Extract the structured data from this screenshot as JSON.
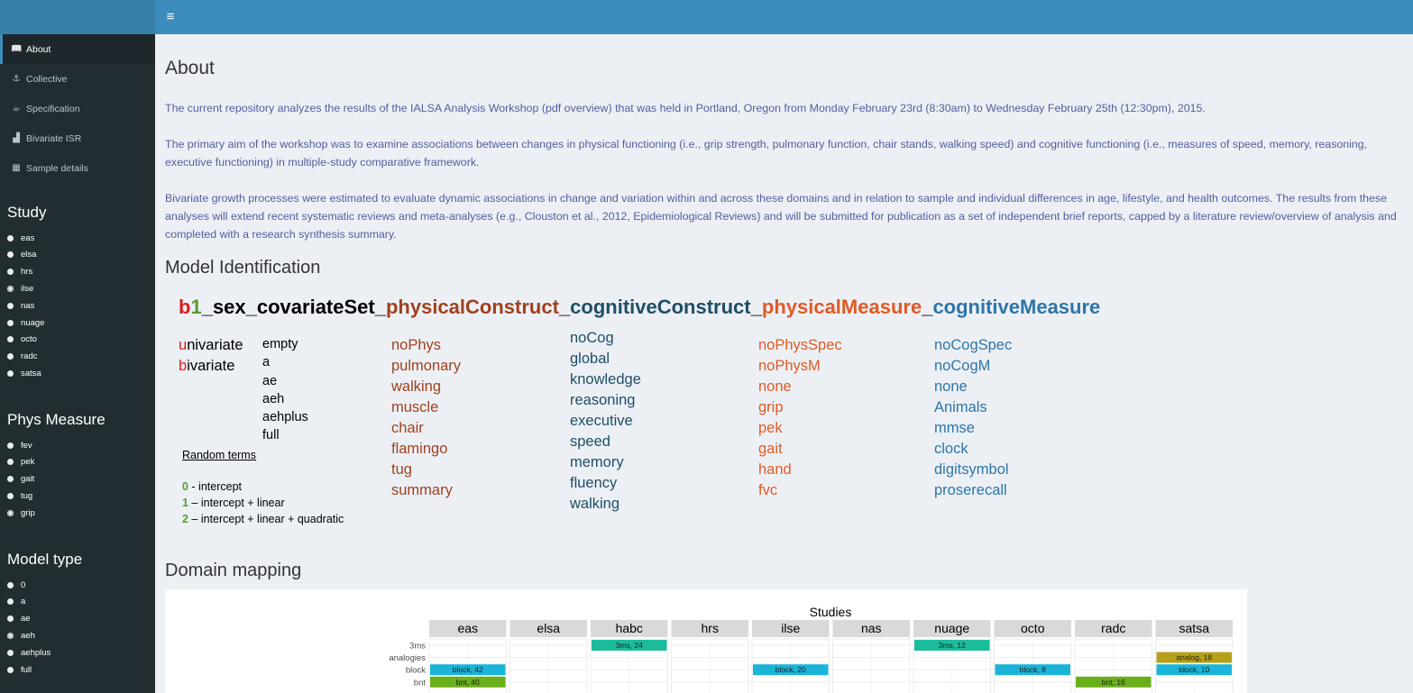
{
  "header": {
    "menu_icon": "hamburger-icon"
  },
  "sidebar": {
    "menu": [
      {
        "label": "About",
        "icon": "book-icon",
        "glyph": "📖",
        "active": true
      },
      {
        "label": "Collective",
        "icon": "anchor-icon",
        "glyph": "⚓",
        "active": false
      },
      {
        "label": "Specification",
        "icon": "coffee-icon",
        "glyph": "☕",
        "active": false
      },
      {
        "label": "Bivariate ISR",
        "icon": "area-chart-icon",
        "glyph": "▟",
        "active": false
      },
      {
        "label": "Sample details",
        "icon": "table-icon",
        "glyph": "▦",
        "active": false
      }
    ],
    "study": {
      "heading": "Study",
      "options": [
        "eas",
        "elsa",
        "hrs",
        "ilse",
        "nas",
        "nuage",
        "octo",
        "radc",
        "satsa"
      ],
      "selected": "ilse"
    },
    "phys_measure": {
      "heading": "Phys Measure",
      "options": [
        "fev",
        "pek",
        "gait",
        "tug",
        "grip"
      ],
      "selected": "grip"
    },
    "model_type": {
      "heading": "Model type",
      "options": [
        "0",
        "a",
        "ae",
        "aeh",
        "aehplus",
        "full"
      ],
      "selected": "aeh"
    }
  },
  "main": {
    "title": "About",
    "paragraphs": [
      "The current repository analyzes the results of the IALSA Analysis Workshop (pdf overview) that was held in Portland, Oregon from Monday February 23rd (8:30am) to Wednesday February 25th (12:30pm), 2015.",
      "The primary aim of the workshop was to examine associations between changes in physical functioning (i.e., grip strength, pulmonary function, chair stands, walking speed) and cognitive functioning (i.e., measures of speed, memory, reasoning, executive functioning) in multiple-study comparative framework.",
      "Bivariate growth processes were estimated to evaluate dynamic associations in change and variation within and across these domains and in relation to sample and individual differences in age, lifestyle, and health outcomes. The results from these analyses will extend recent systematic reviews and meta-analyses (e.g., Clouston et al., 2012, Epidemiological Reviews) and will be submitted for publication as a set of independent brief reports, capped by a literature review/overview of analysis and completed with a research synthesis summary."
    ],
    "model_identification": {
      "heading": "Model Identification",
      "title_parts": [
        "b",
        "1",
        "_sex_covariateSet_",
        "physicalConstruct",
        "_",
        "cognitiveConstruct",
        "_",
        "physicalMeasure",
        "_",
        "cognitiveMeasure"
      ],
      "type_first": [
        "u",
        "nivariate"
      ],
      "type_second": [
        "b",
        "ivariate"
      ],
      "covariate_sets": [
        "empty",
        "a",
        "ae",
        "aeh",
        "aehplus",
        "full"
      ],
      "physical_constructs": [
        "noPhys",
        "pulmonary",
        "walking",
        "muscle",
        "chair",
        "flamingo",
        "tug",
        "summary"
      ],
      "cognitive_constructs": [
        "noCog",
        "global",
        "knowledge",
        "reasoning",
        "executive",
        "speed",
        "memory",
        "fluency",
        "walking"
      ],
      "physical_measures": [
        "noPhysSpec",
        "noPhysM",
        "none",
        "grip",
        "pek",
        "gait",
        "hand",
        "fvc"
      ],
      "cognitive_measures": [
        "noCogSpec",
        "noCogM",
        "none",
        "Animals",
        "mmse",
        "clock",
        "digitsymbol",
        "proserecall"
      ],
      "random_terms_heading": "Random terms",
      "random_terms": [
        {
          "num": "0",
          "sep": " -  ",
          "text": "intercept"
        },
        {
          "num": "1",
          "sep": " – ",
          "text": "intercept + linear"
        },
        {
          "num": "2",
          "sep": " – ",
          "text": "intercept + linear + quadratic"
        }
      ]
    },
    "domain_mapping": {
      "heading": "Domain mapping"
    }
  },
  "chart_data": {
    "type": "heatmap",
    "title": "Studies",
    "studies": [
      "eas",
      "elsa",
      "habc",
      "hrs",
      "ilse",
      "nas",
      "nuage",
      "octo",
      "radc",
      "satsa"
    ],
    "rows": [
      "3ms",
      "analogies",
      "block",
      "bnt"
    ],
    "cells": [
      {
        "study": "habc",
        "row": "3ms",
        "label": "3ms, 24",
        "color": "#1abc9c"
      },
      {
        "study": "nuage",
        "row": "3ms",
        "label": "3ms, 12",
        "color": "#1abc9c"
      },
      {
        "study": "satsa",
        "row": "analogies",
        "label": "analog, 18",
        "color": "#b5a019"
      },
      {
        "study": "eas",
        "row": "block",
        "label": "block, 42",
        "color": "#1ab4d8"
      },
      {
        "study": "ilse",
        "row": "block",
        "label": "block, 20",
        "color": "#1ab4d8"
      },
      {
        "study": "octo",
        "row": "block",
        "label": "block, 8",
        "color": "#1ab4d8"
      },
      {
        "study": "satsa",
        "row": "block",
        "label": "block, 10",
        "color": "#1ab4d8"
      },
      {
        "study": "eas",
        "row": "bnt",
        "label": "bnt, 40",
        "color": "#6aae1a"
      },
      {
        "study": "radc",
        "row": "bnt",
        "label": "bnt, 16",
        "color": "#6aae1a"
      }
    ]
  }
}
